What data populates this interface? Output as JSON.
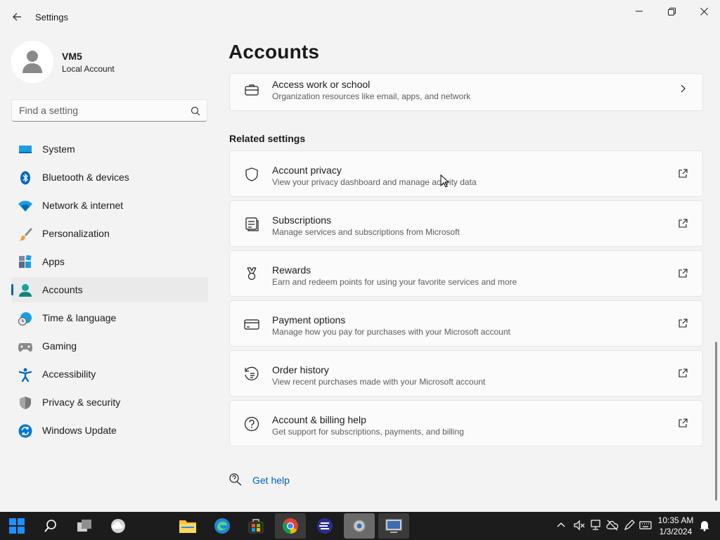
{
  "window": {
    "title": "Settings"
  },
  "profile": {
    "name": "VM5",
    "account_type": "Local Account"
  },
  "search": {
    "placeholder": "Find a setting"
  },
  "nav": {
    "items": [
      {
        "label": "System",
        "icon": "monitor-icon"
      },
      {
        "label": "Bluetooth & devices",
        "icon": "bluetooth-icon"
      },
      {
        "label": "Network & internet",
        "icon": "wifi-icon"
      },
      {
        "label": "Personalization",
        "icon": "brush-icon"
      },
      {
        "label": "Apps",
        "icon": "apps-icon"
      },
      {
        "label": "Accounts",
        "icon": "person-icon",
        "selected": true
      },
      {
        "label": "Time & language",
        "icon": "globe-clock-icon"
      },
      {
        "label": "Gaming",
        "icon": "gamepad-icon"
      },
      {
        "label": "Accessibility",
        "icon": "accessibility-icon"
      },
      {
        "label": "Privacy & security",
        "icon": "shield-icon"
      },
      {
        "label": "Windows Update",
        "icon": "refresh-icon"
      }
    ]
  },
  "main": {
    "title": "Accounts",
    "top_card": {
      "title": "Access work or school",
      "description": "Organization resources like email, apps, and network",
      "icon": "briefcase-icon",
      "action": "chevron-right-icon"
    },
    "related_label": "Related settings",
    "related": [
      {
        "title": "Account privacy",
        "description": "View your privacy dashboard and manage activity data",
        "icon": "shield-outline-icon"
      },
      {
        "title": "Subscriptions",
        "description": "Manage services and subscriptions from Microsoft",
        "icon": "subscriptions-icon"
      },
      {
        "title": "Rewards",
        "description": "Earn and redeem points for using your favorite services and more",
        "icon": "trophy-icon"
      },
      {
        "title": "Payment options",
        "description": "Manage how you pay for purchases with your Microsoft account",
        "icon": "credit-card-icon"
      },
      {
        "title": "Order history",
        "description": "View recent purchases made with your Microsoft account",
        "icon": "history-icon"
      },
      {
        "title": "Account & billing help",
        "description": "Get support for subscriptions, payments, and billing",
        "icon": "help-icon"
      }
    ],
    "get_help": "Get help"
  },
  "taskbar": {
    "time": "10:35 AM",
    "date": "1/3/2024"
  },
  "colors": {
    "accent": "#005fb8",
    "taskbar": "#1c1c1c",
    "background": "#f3f3f3"
  }
}
